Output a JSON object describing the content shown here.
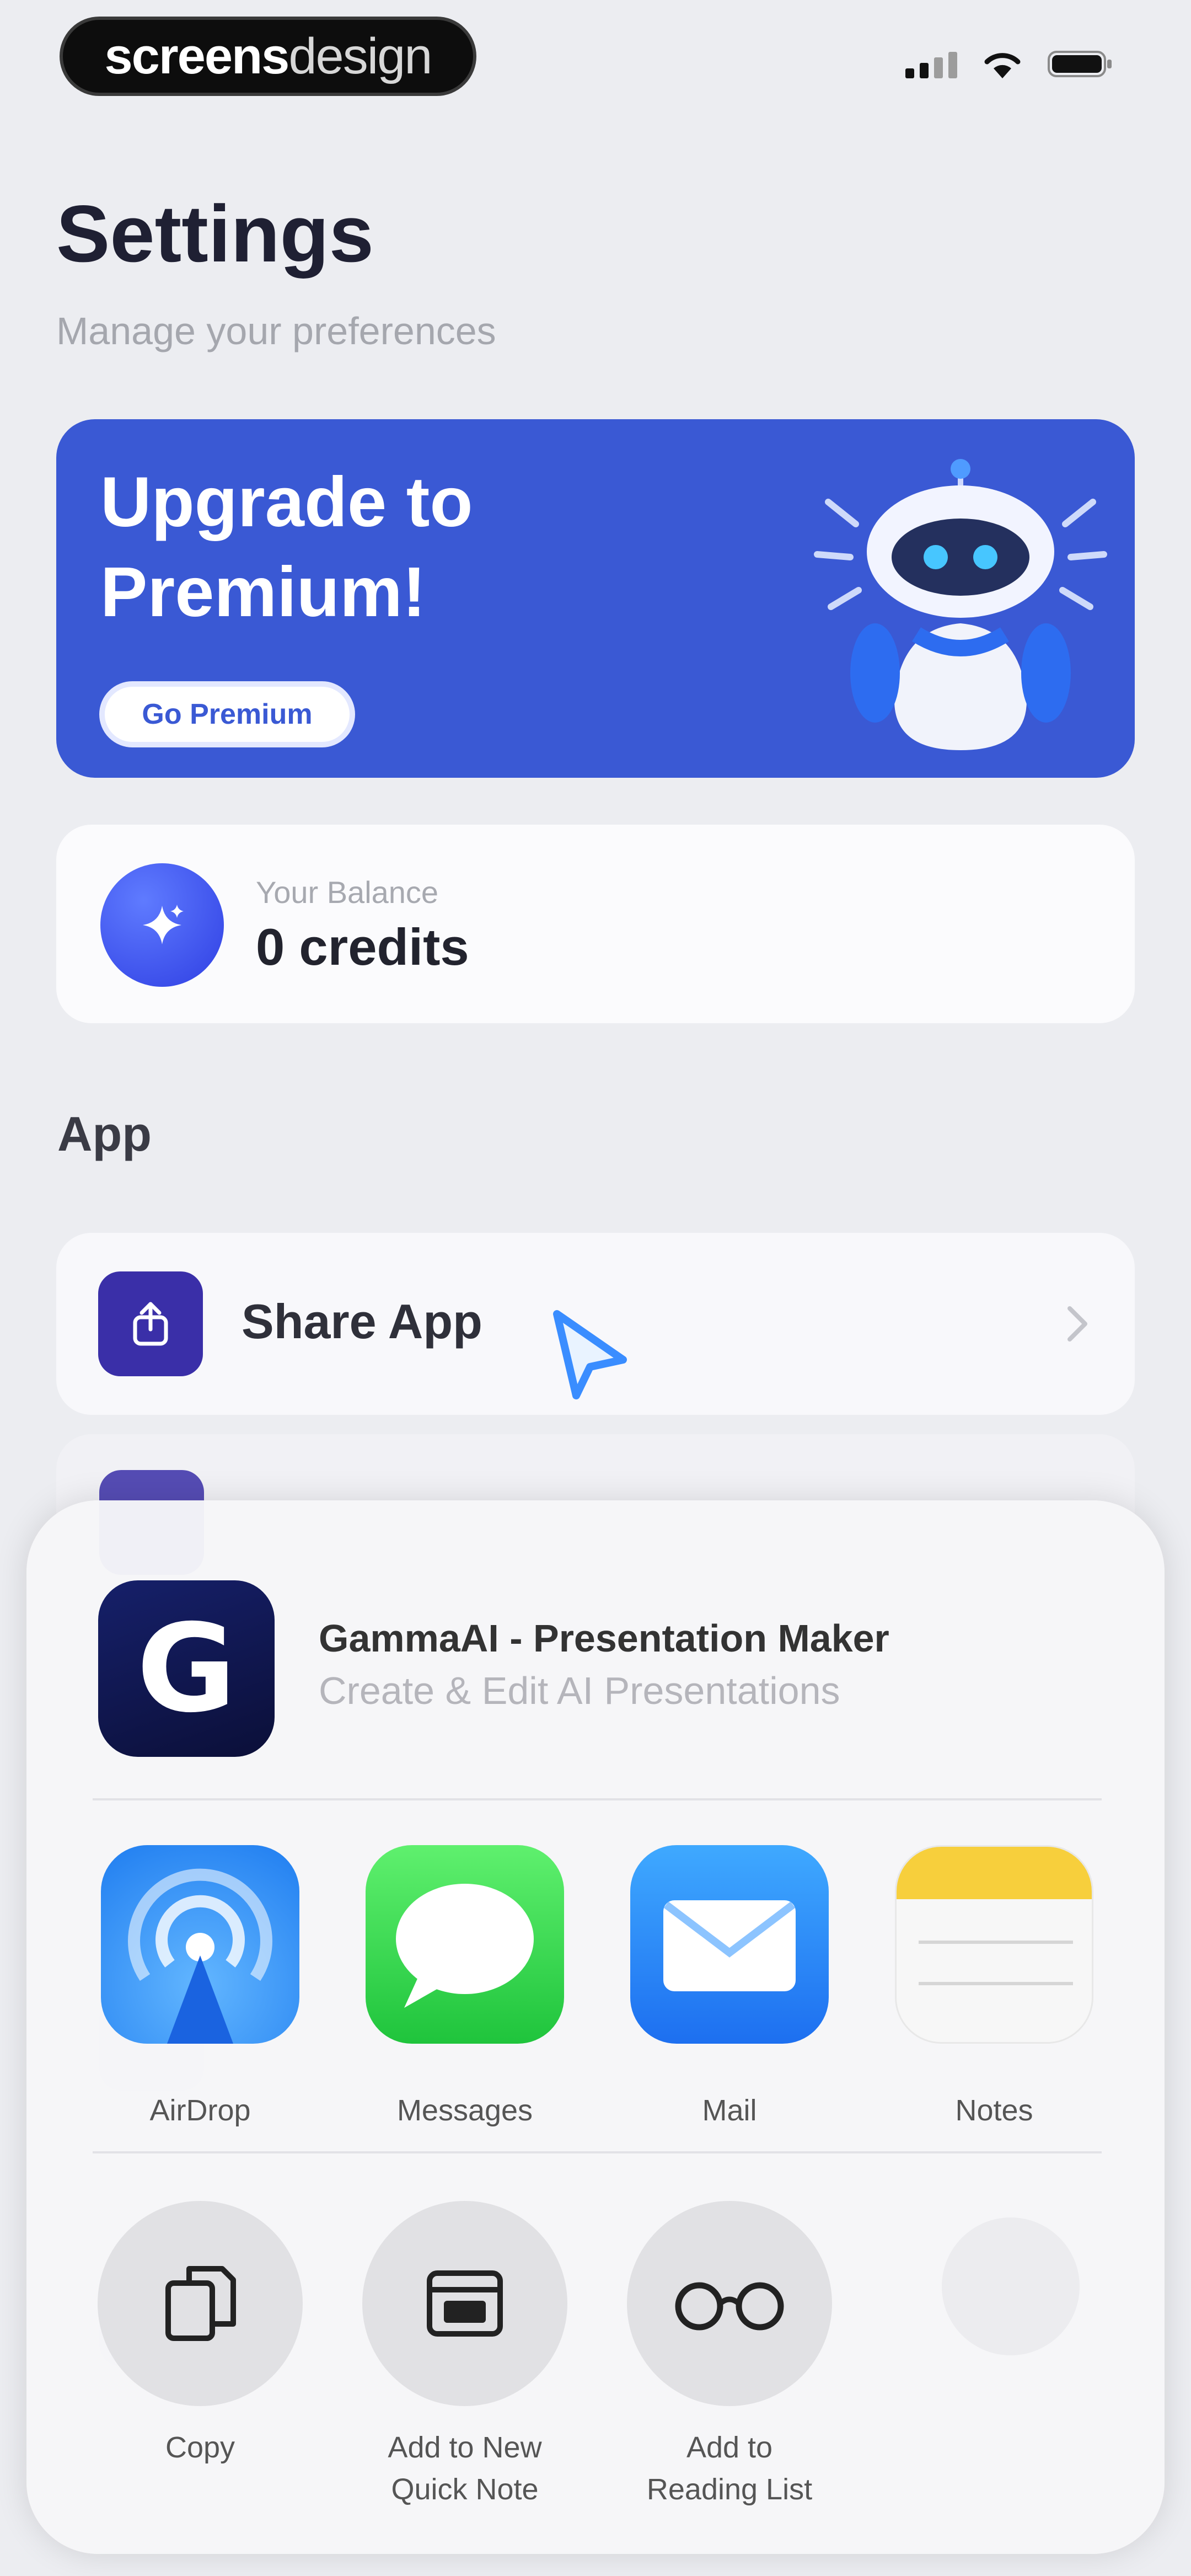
{
  "status_bar": {
    "brand_part1": "screens",
    "brand_part2": "design"
  },
  "header": {
    "title": "Settings",
    "subtitle": "Manage your preferences"
  },
  "premium_card": {
    "title": "Upgrade to Premium!",
    "button_label": "Go Premium",
    "accent_color": "#3a59d4"
  },
  "balance": {
    "label": "Your Balance",
    "value": "0 credits"
  },
  "sections": {
    "app_label": "App"
  },
  "rows": {
    "share_app": "Share App"
  },
  "share_sheet": {
    "app_name": "GammaAI - Presentation Maker",
    "app_description": "Create & Edit AI Presentations",
    "app_icon_letter": "G",
    "targets": [
      {
        "label": "AirDrop",
        "icon": "airdrop-icon"
      },
      {
        "label": "Messages",
        "icon": "messages-icon"
      },
      {
        "label": "Mail",
        "icon": "mail-icon"
      },
      {
        "label": "Notes",
        "icon": "notes-icon"
      }
    ],
    "actions": [
      {
        "label": "Copy",
        "icon": "copy-icon"
      },
      {
        "label": "Add to New Quick Note",
        "icon": "quick-note-icon"
      },
      {
        "label": "Add to Reading List",
        "icon": "reading-list-icon"
      }
    ]
  }
}
